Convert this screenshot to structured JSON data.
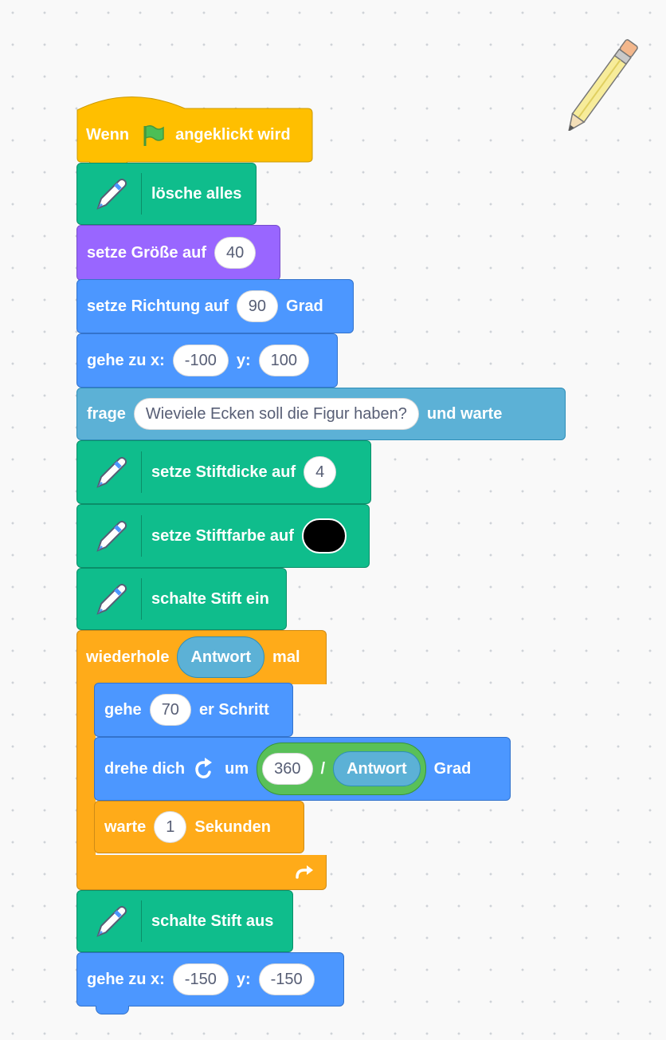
{
  "script": {
    "when_flag": {
      "before": "Wenn",
      "after": "angeklickt wird",
      "flag_icon": "green-flag-icon"
    },
    "clear": {
      "label": "lösche alles"
    },
    "set_size": {
      "label": "setze Größe auf",
      "value": "40"
    },
    "point_direction": {
      "label": "setze Richtung auf",
      "value": "90",
      "suffix": "Grad"
    },
    "goto_1": {
      "label": "gehe zu x:",
      "x": "-100",
      "ylabel": "y:",
      "y": "100"
    },
    "ask": {
      "label": "frage",
      "question": "Wieviele Ecken soll die Figur haben?",
      "suffix": "und warte"
    },
    "pen_size": {
      "label": "setze Stiftdicke auf",
      "value": "4"
    },
    "pen_color": {
      "label": "setze Stiftfarbe auf",
      "color": "#000000"
    },
    "pen_down": {
      "label": "schalte Stift ein"
    },
    "repeat": {
      "label": "wiederhole",
      "reporter": "Antwort",
      "suffix": "mal",
      "loop_icon": "repeat-arrow-icon"
    },
    "move": {
      "label": "gehe",
      "value": "70",
      "suffix": "er Schritt"
    },
    "turn": {
      "label": "drehe dich",
      "icon": "rotate-right-icon",
      "um": "um",
      "numerator": "360",
      "slash": "/",
      "reporter": "Antwort",
      "suffix": "Grad"
    },
    "wait": {
      "label": "warte",
      "value": "1",
      "suffix": "Sekunden"
    },
    "pen_up": {
      "label": "schalte Stift aus"
    },
    "goto_2": {
      "label": "gehe zu x:",
      "x": "-150",
      "ylabel": "y:",
      "y": "-150"
    }
  },
  "colors": {
    "motion": "#4c97ff",
    "looks": "#9966ff",
    "sensing": "#5cb1d6",
    "pen": "#0fbd8c",
    "events": "#ffbf00",
    "control": "#ffab19",
    "operators": "#59c059"
  },
  "sprite_icon": "pencil-icon"
}
